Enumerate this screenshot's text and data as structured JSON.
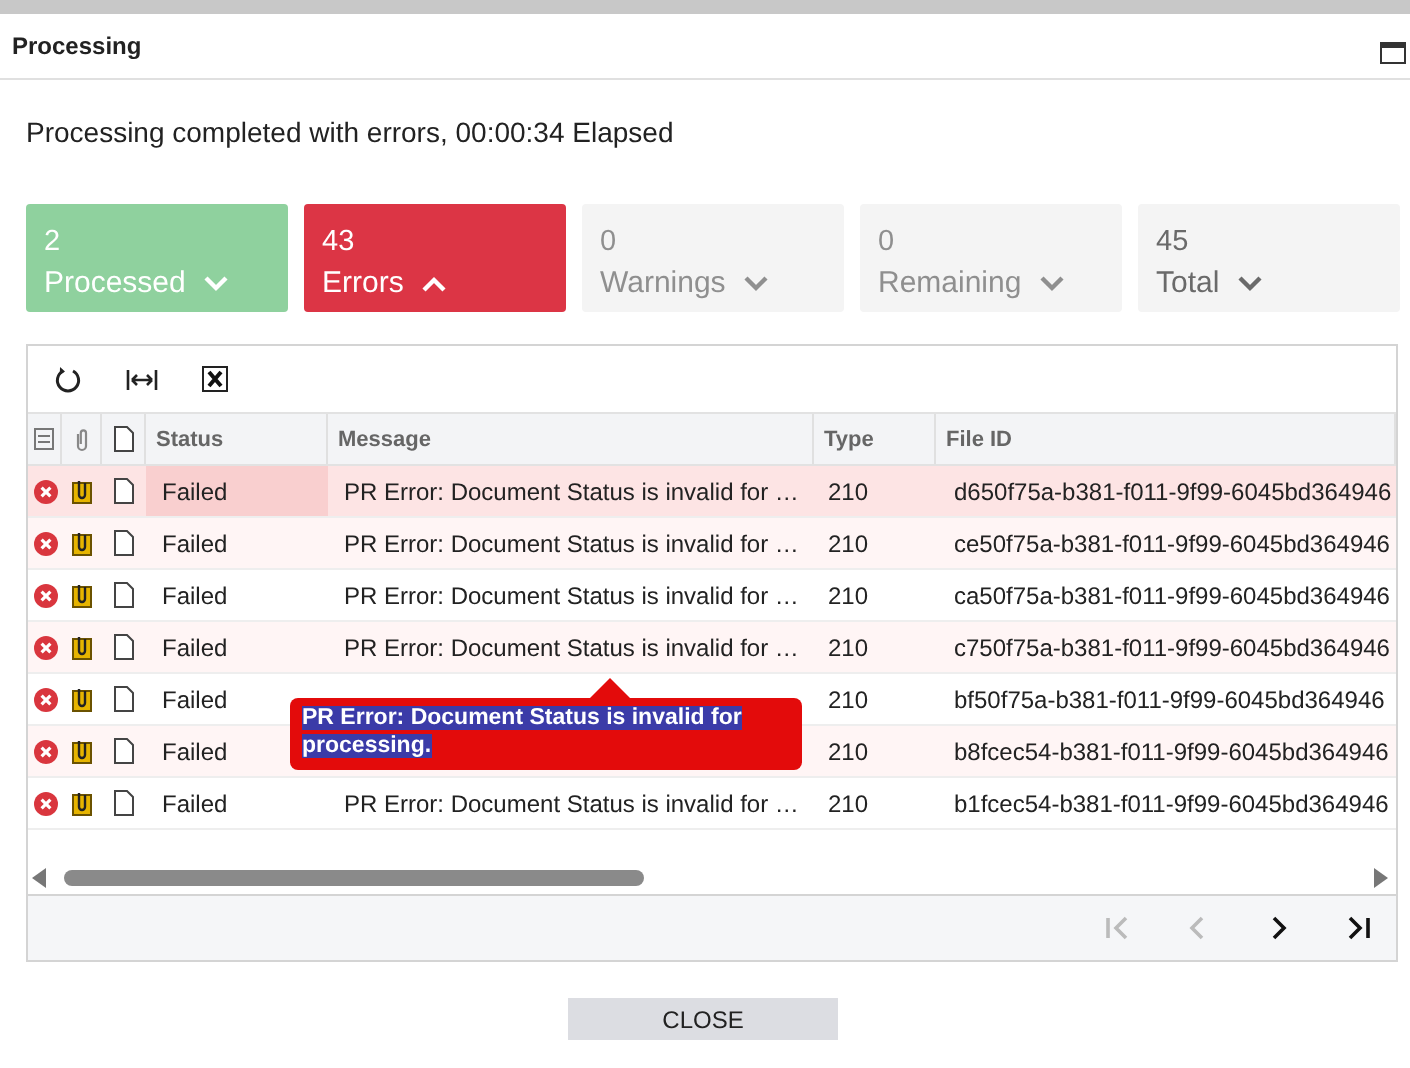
{
  "window": {
    "title": "Processing"
  },
  "status_message": "Processing completed with errors, 00:00:34 Elapsed",
  "summary": [
    {
      "count": "2",
      "label": "Processed",
      "color": "#8fd19e",
      "expanded": false,
      "disabled": false
    },
    {
      "count": "43",
      "label": "Errors",
      "color": "#dc3545",
      "expanded": true,
      "disabled": false
    },
    {
      "count": "0",
      "label": "Warnings",
      "color": "#f4f4f4",
      "expanded": false,
      "disabled": true
    },
    {
      "count": "0",
      "label": "Remaining",
      "color": "#f4f4f4",
      "expanded": false,
      "disabled": true
    },
    {
      "count": "45",
      "label": "Total",
      "color": "#f4f4f4",
      "expanded": false,
      "disabled": false
    }
  ],
  "table": {
    "columns": [
      "Status",
      "Message",
      "Type",
      "File ID"
    ],
    "rows": [
      {
        "status": "Failed",
        "message": "PR Error: Document Status is invalid for …",
        "type": "210",
        "file_id": "d650f75a-b381-f011-9f99-6045bd364946",
        "selected": true
      },
      {
        "status": "Failed",
        "message": "PR Error: Document Status is invalid for …",
        "type": "210",
        "file_id": "ce50f75a-b381-f011-9f99-6045bd364946",
        "selected": false
      },
      {
        "status": "Failed",
        "message": "PR Error: Document Status is invalid for …",
        "type": "210",
        "file_id": "ca50f75a-b381-f011-9f99-6045bd364946",
        "selected": false
      },
      {
        "status": "Failed",
        "message": "PR Error: Document Status is invalid for …",
        "type": "210",
        "file_id": "c750f75a-b381-f011-9f99-6045bd364946",
        "selected": false
      },
      {
        "status": "Failed",
        "type": "210",
        "file_id": "bf50f75a-b381-f011-9f99-6045bd364946",
        "selected": false
      },
      {
        "status": "Failed",
        "type": "210",
        "file_id": "b8fcec54-b381-f011-9f99-6045bd364946",
        "selected": false
      },
      {
        "status": "Failed",
        "message": "PR Error: Document Status is invalid for …",
        "type": "210",
        "file_id": "b1fcec54-b381-f011-9f99-6045bd364946",
        "selected": false
      }
    ]
  },
  "tooltip": {
    "text": "PR Error: Document Status is invalid for processing."
  },
  "pager": [
    {
      "kind": "first",
      "disabled": true
    },
    {
      "kind": "prev",
      "disabled": true
    },
    {
      "kind": "next",
      "disabled": false
    },
    {
      "kind": "last",
      "disabled": false
    }
  ],
  "close_button": "CLOSE"
}
